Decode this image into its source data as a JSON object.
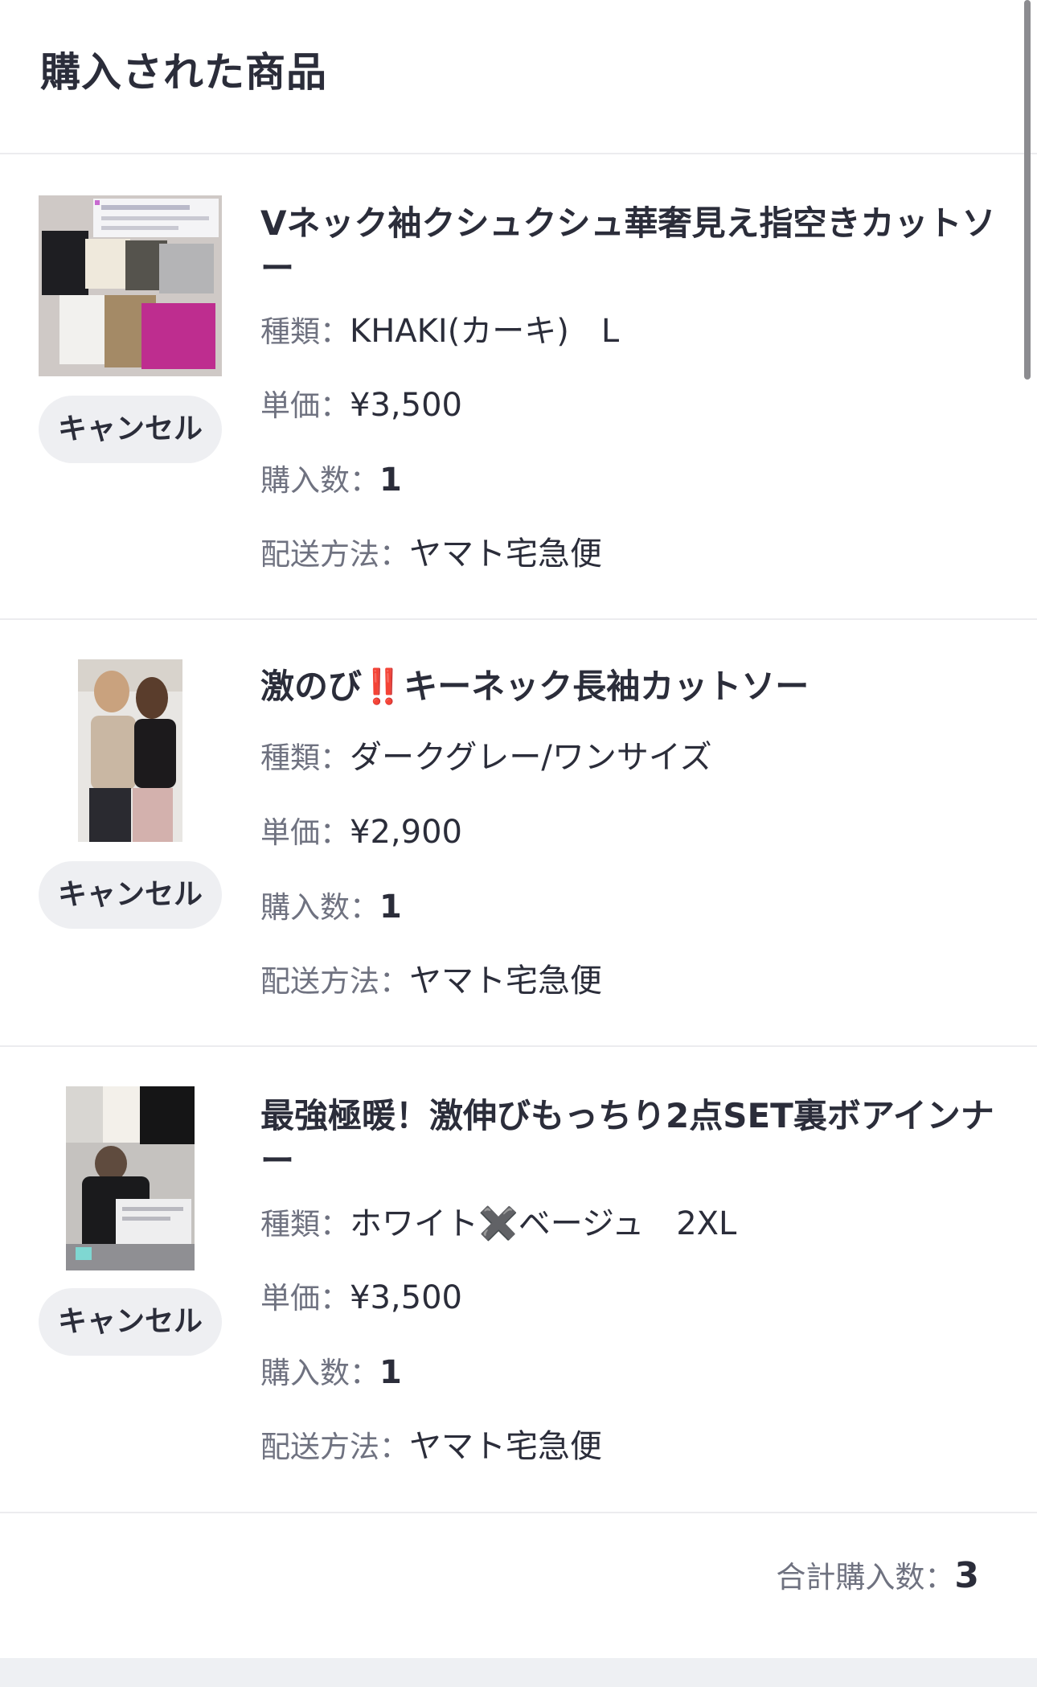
{
  "page": {
    "title": "購入された商品"
  },
  "items": [
    {
      "name": "Vネック袖クシュクシュ華奢見え指空きカットソー",
      "variant_label": "種類：",
      "variant": "KHAKI(カーキ)　L",
      "price_label": "単価：",
      "price": "¥3,500",
      "qty_label": "購入数：",
      "qty": "1",
      "shipping_label": "配送方法：",
      "shipping": "ヤマト宅急便",
      "cancel_label": "キャンセル"
    },
    {
      "name": "激のび‼️キーネック長袖カットソー",
      "variant_label": "種類：",
      "variant": "ダークグレー/ワンサイズ",
      "price_label": "単価：",
      "price": "¥2,900",
      "qty_label": "購入数：",
      "qty": "1",
      "shipping_label": "配送方法：",
      "shipping": "ヤマト宅急便",
      "cancel_label": "キャンセル"
    },
    {
      "name": "最強極暖！激伸びもっちり2点SET裏ボアインナー",
      "variant_label": "種類：",
      "variant": "ホワイト✖️ベージュ　2XL",
      "price_label": "単価：",
      "price": "¥3,500",
      "qty_label": "購入数：",
      "qty": "1",
      "shipping_label": "配送方法：",
      "shipping": "ヤマト宅急便",
      "cancel_label": "キャンセル"
    }
  ],
  "summary": {
    "total_label": "合計購入数：",
    "total": "3"
  },
  "colors": {
    "text": "#2b2d3a",
    "label": "#6f7280",
    "button_bg": "#eeeff2",
    "divider": "#ececef"
  }
}
